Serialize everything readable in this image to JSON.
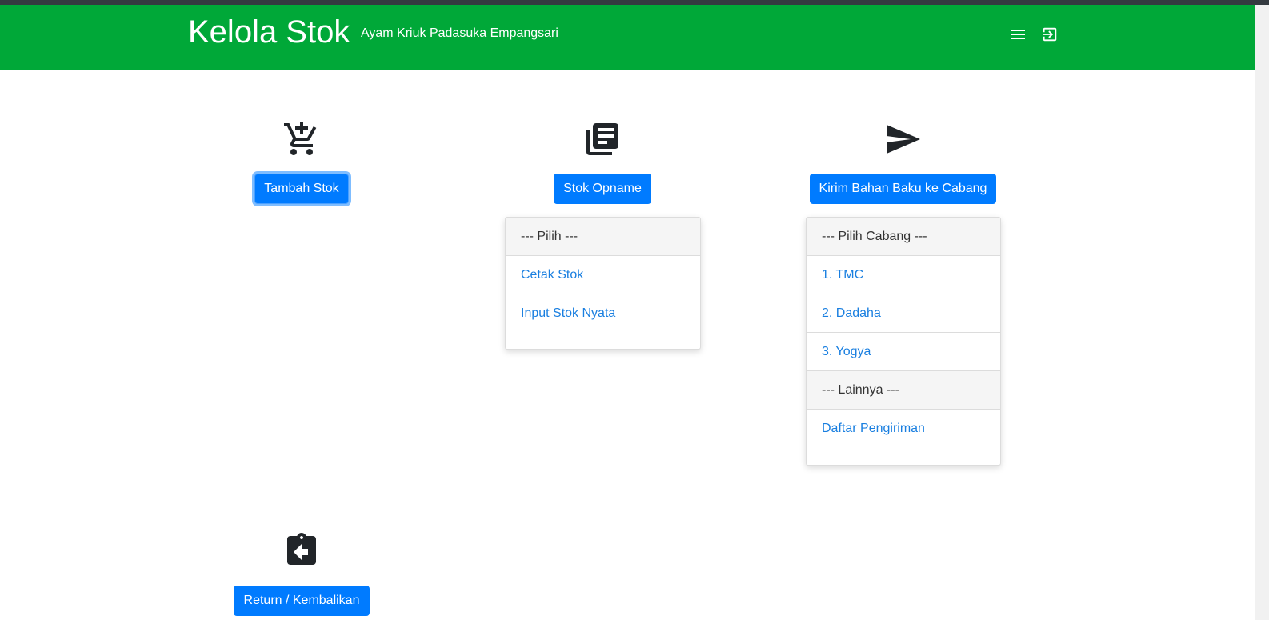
{
  "header": {
    "brand": "Kelola Stok",
    "subtitle": "Ayam Kriuk Padasuka Empangsari",
    "menu_icon": "menu-icon",
    "logout_icon": "logout-icon"
  },
  "cards": {
    "tambah": {
      "icon": "add-shopping-cart-icon",
      "label": "Tambah Stok"
    },
    "opname": {
      "icon": "library-books-icon",
      "label": "Stok Opname",
      "dropdown": {
        "header": "--- Pilih ---",
        "items": [
          "Cetak Stok",
          "Input Stok Nyata"
        ]
      }
    },
    "kirim": {
      "icon": "send-icon",
      "label": "Kirim Bahan Baku ke Cabang",
      "dropdown": {
        "header": "--- Pilih Cabang ---",
        "items": [
          "1. TMC",
          "2. Dadaha",
          "3. Yogya"
        ],
        "header2": "--- Lainnya ---",
        "items2": [
          "Daftar Pengiriman"
        ]
      }
    },
    "return": {
      "icon": "assignment-return-icon",
      "label": "Return / Kembalikan"
    }
  },
  "colors": {
    "navbar": "#00a838",
    "primary": "#007bff",
    "link": "#1a7fe0"
  }
}
